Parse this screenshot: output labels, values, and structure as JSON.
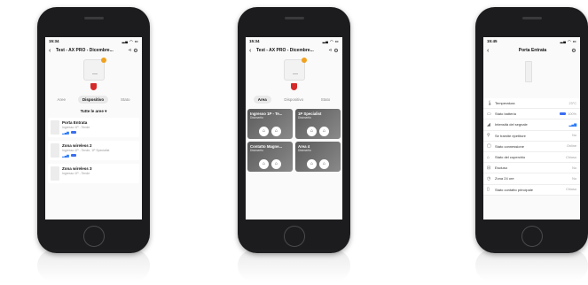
{
  "phones": [
    {
      "time": "15:34",
      "title": "Test - AX PRO - Dicembre...",
      "tabs": [
        "Aree",
        "Dispositivo",
        "Stato"
      ],
      "active_tab": "Dispositivo",
      "area_filter": "Tutte le aree",
      "devices": [
        {
          "name": "Porta Entrata",
          "sub": "Ingresso 1P - Tende"
        },
        {
          "name": "Zona wireless 2",
          "sub": "Ingresso 1P - Tende, 1P Specialist"
        },
        {
          "name": "Zona wireless 3",
          "sub": "Ingresso 1P - Tende"
        }
      ]
    },
    {
      "time": "15:34",
      "title": "Test - AX PRO - Dicembre...",
      "tabs": [
        "Area",
        "Dispositivo",
        "Stato"
      ],
      "active_tab": "Area",
      "areas": [
        {
          "name": "Ingresso 1P - Te...",
          "sub": "Disinserito"
        },
        {
          "name": "1P Specialist",
          "sub": "Disinserito"
        },
        {
          "name": "Contatto Magne...",
          "sub": "Disinserito"
        },
        {
          "name": "Area 4",
          "sub": "Disinserito"
        }
      ]
    },
    {
      "time": "15:45",
      "title": "Porta Entrata",
      "properties": [
        {
          "icon": "thermometer-icon",
          "label": "Temperatura",
          "value": "23°C"
        },
        {
          "icon": "battery-icon",
          "label": "Stato batteria",
          "value": "100%"
        },
        {
          "icon": "signal-icon",
          "label": "Intensità del segnale",
          "value": ""
        },
        {
          "icon": "repeater-icon",
          "label": "Se tramite ripetitore",
          "value": "No"
        },
        {
          "icon": "connection-icon",
          "label": "Stato connessione",
          "value": "Online"
        },
        {
          "icon": "cover-icon",
          "label": "Stato del coperchio",
          "value": "Chiuso"
        },
        {
          "icon": "exclude-icon",
          "label": "Escluso",
          "value": "No"
        },
        {
          "icon": "24h-icon",
          "label": "Zona 24 ore",
          "value": "No"
        },
        {
          "icon": "contact-icon",
          "label": "Stato contatto principale",
          "value": "Chiuso"
        }
      ]
    }
  ]
}
